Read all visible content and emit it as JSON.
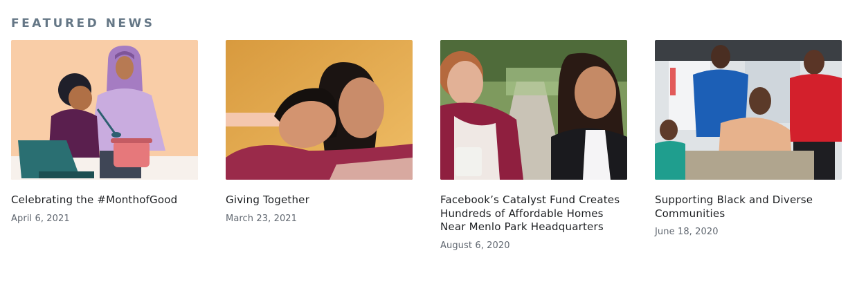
{
  "section": {
    "heading": "FEATURED NEWS"
  },
  "articles": [
    {
      "title": "Celebrating the #MonthofGood",
      "date": "April 6, 2021",
      "image": "illustration-family-cooking"
    },
    {
      "title": "Giving Together",
      "date": "March 23, 2021",
      "image": "photo-two-women-embracing"
    },
    {
      "title": "Facebook’s Catalyst Fund Creates Hundreds of Affordable Homes Near Menlo Park Headquarters",
      "date": "August 6, 2020",
      "image": "photo-women-outdoor-path"
    },
    {
      "title": "Supporting Black and Diverse Communities",
      "date": "June 18, 2020",
      "image": "photo-barbershop-group"
    }
  ],
  "colors": {
    "heading": "#657786",
    "title": "#1c1e21",
    "date": "#606770"
  }
}
